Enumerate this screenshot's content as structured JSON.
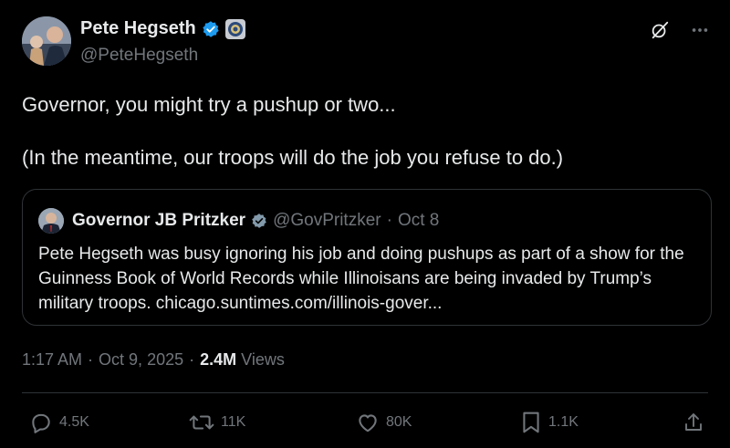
{
  "header": {
    "name": "Pete Hegseth",
    "handle": "@PeteHegseth",
    "verified_color": "#1d9bf0",
    "icons": [
      "grok-icon",
      "more-icon"
    ]
  },
  "tweet": {
    "line1": "Governor, you might try a pushup or two...",
    "line2": "(In the meantime, our troops will do the job you refuse to do.)"
  },
  "quote": {
    "name": "Governor JB Pritzker",
    "handle": "@GovPritzker",
    "separator": "·",
    "date": "Oct 8",
    "text": "Pete Hegseth was busy ignoring his job and doing pushups as part of a show for the Guinness Book of World Records while Illinoisans are being invaded by Trump’s military troops. chicago.suntimes.com/illinois-gover..."
  },
  "meta": {
    "time": "1:17 AM",
    "sep1": "·",
    "date": "Oct 9, 2025",
    "sep2": "·",
    "views_count": "2.4M",
    "views_label": "Views"
  },
  "actions": {
    "replies": "4.5K",
    "reposts": "11K",
    "likes": "80K",
    "bookmarks": "1.1K"
  }
}
